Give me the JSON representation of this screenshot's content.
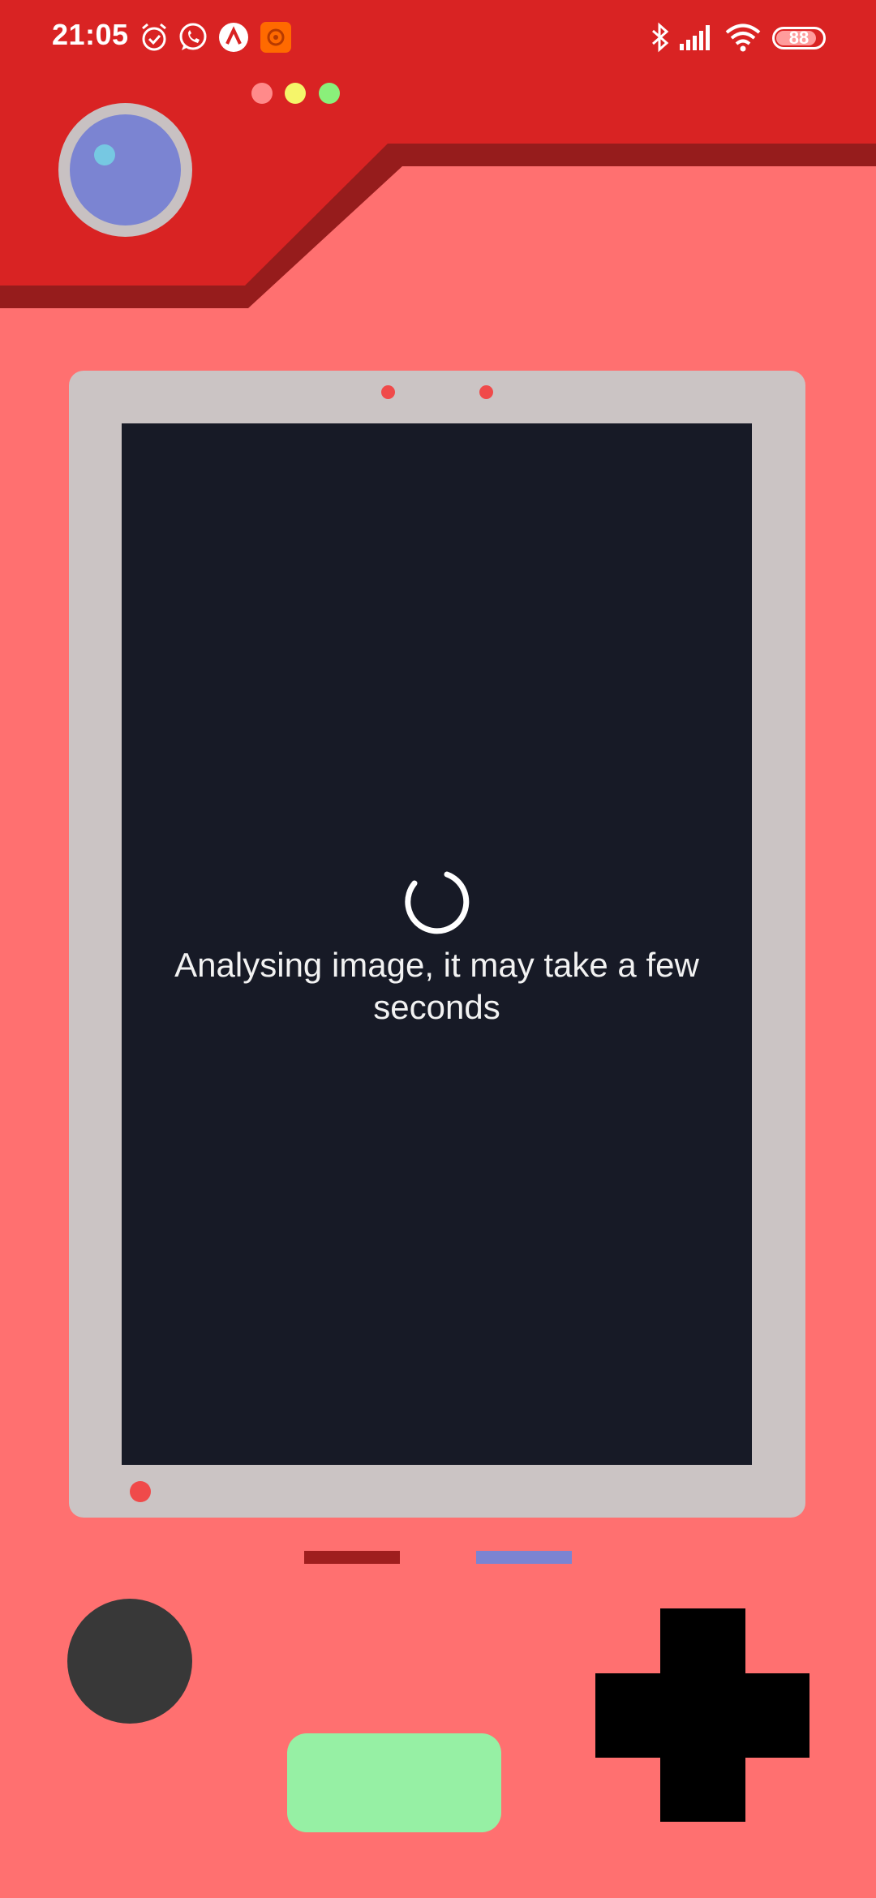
{
  "status_bar": {
    "time": "21:05",
    "left_icons": [
      "alarm-icon",
      "whatsapp-icon",
      "app-a-icon",
      "record-app-icon"
    ],
    "right_icons": [
      "bluetooth-icon",
      "signal-icon",
      "wifi-icon"
    ],
    "battery": "88",
    "battery_level": 0.88
  },
  "indicator_lights": [
    {
      "name": "red-light",
      "color": "#ff8a8a"
    },
    {
      "name": "yellow-light",
      "color": "#f5f56a"
    },
    {
      "name": "green-light",
      "color": "#8af07a"
    }
  ],
  "loading": {
    "message": "Analysing image, it may take a few seconds"
  },
  "colors": {
    "background": "#ff7070",
    "header_red": "#d92323",
    "header_shadow": "#961c1c",
    "frame": "#cbc4c4",
    "screen": "#171a26",
    "lens": "#7b84d2",
    "green_button": "#96f0a4",
    "round_button": "#383838"
  }
}
